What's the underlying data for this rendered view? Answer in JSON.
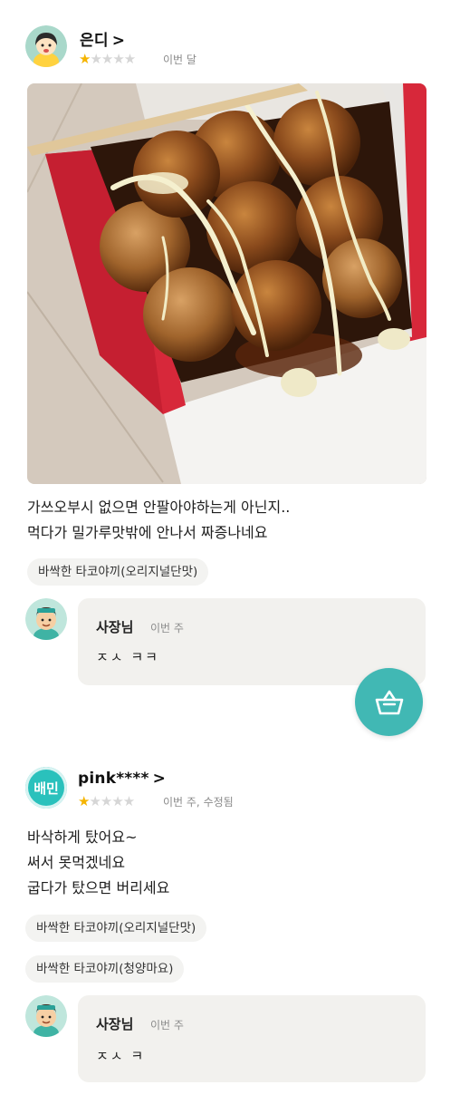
{
  "review1": {
    "username": "은디",
    "chevron": ">",
    "rating": 1,
    "rating_max": 5,
    "time": "이번 달",
    "text": "가쓰오부시 없으면 안팔아야하는게 아닌지..\n먹다가 밀가루맛밖에 안나서 짜증나네요",
    "tags": [
      "바싹한 타코야끼(오리지널단맛)"
    ],
    "owner_reply": {
      "name": "사장님",
      "time": "이번 주",
      "text": "ㅈㅅ ㅋㅋ"
    }
  },
  "review2": {
    "username": "pink****",
    "chevron": ">",
    "rating": 1,
    "rating_max": 5,
    "time": "이번 주, 수정됨",
    "avatar_badge": "배민",
    "text": "바삭하게 탔어요~\n써서 못먹겠네요\n굽다가 탔으면 버리세요",
    "tags": [
      "바싹한 타코야끼(오리지널단맛)",
      "바싹한 타코야끼(청양마요)"
    ],
    "owner_reply": {
      "name": "사장님",
      "time": "이번 주",
      "text": "ㅈㅅ ㅋ"
    }
  },
  "icons": {
    "cart": "basket-icon",
    "star": "star-icon"
  },
  "colors": {
    "star_on": "#f5b400",
    "star_off": "#d6d6d6",
    "fab": "#41b8b4",
    "reply_bg": "#f2f1ee",
    "tag_bg": "#f3f3f1"
  }
}
